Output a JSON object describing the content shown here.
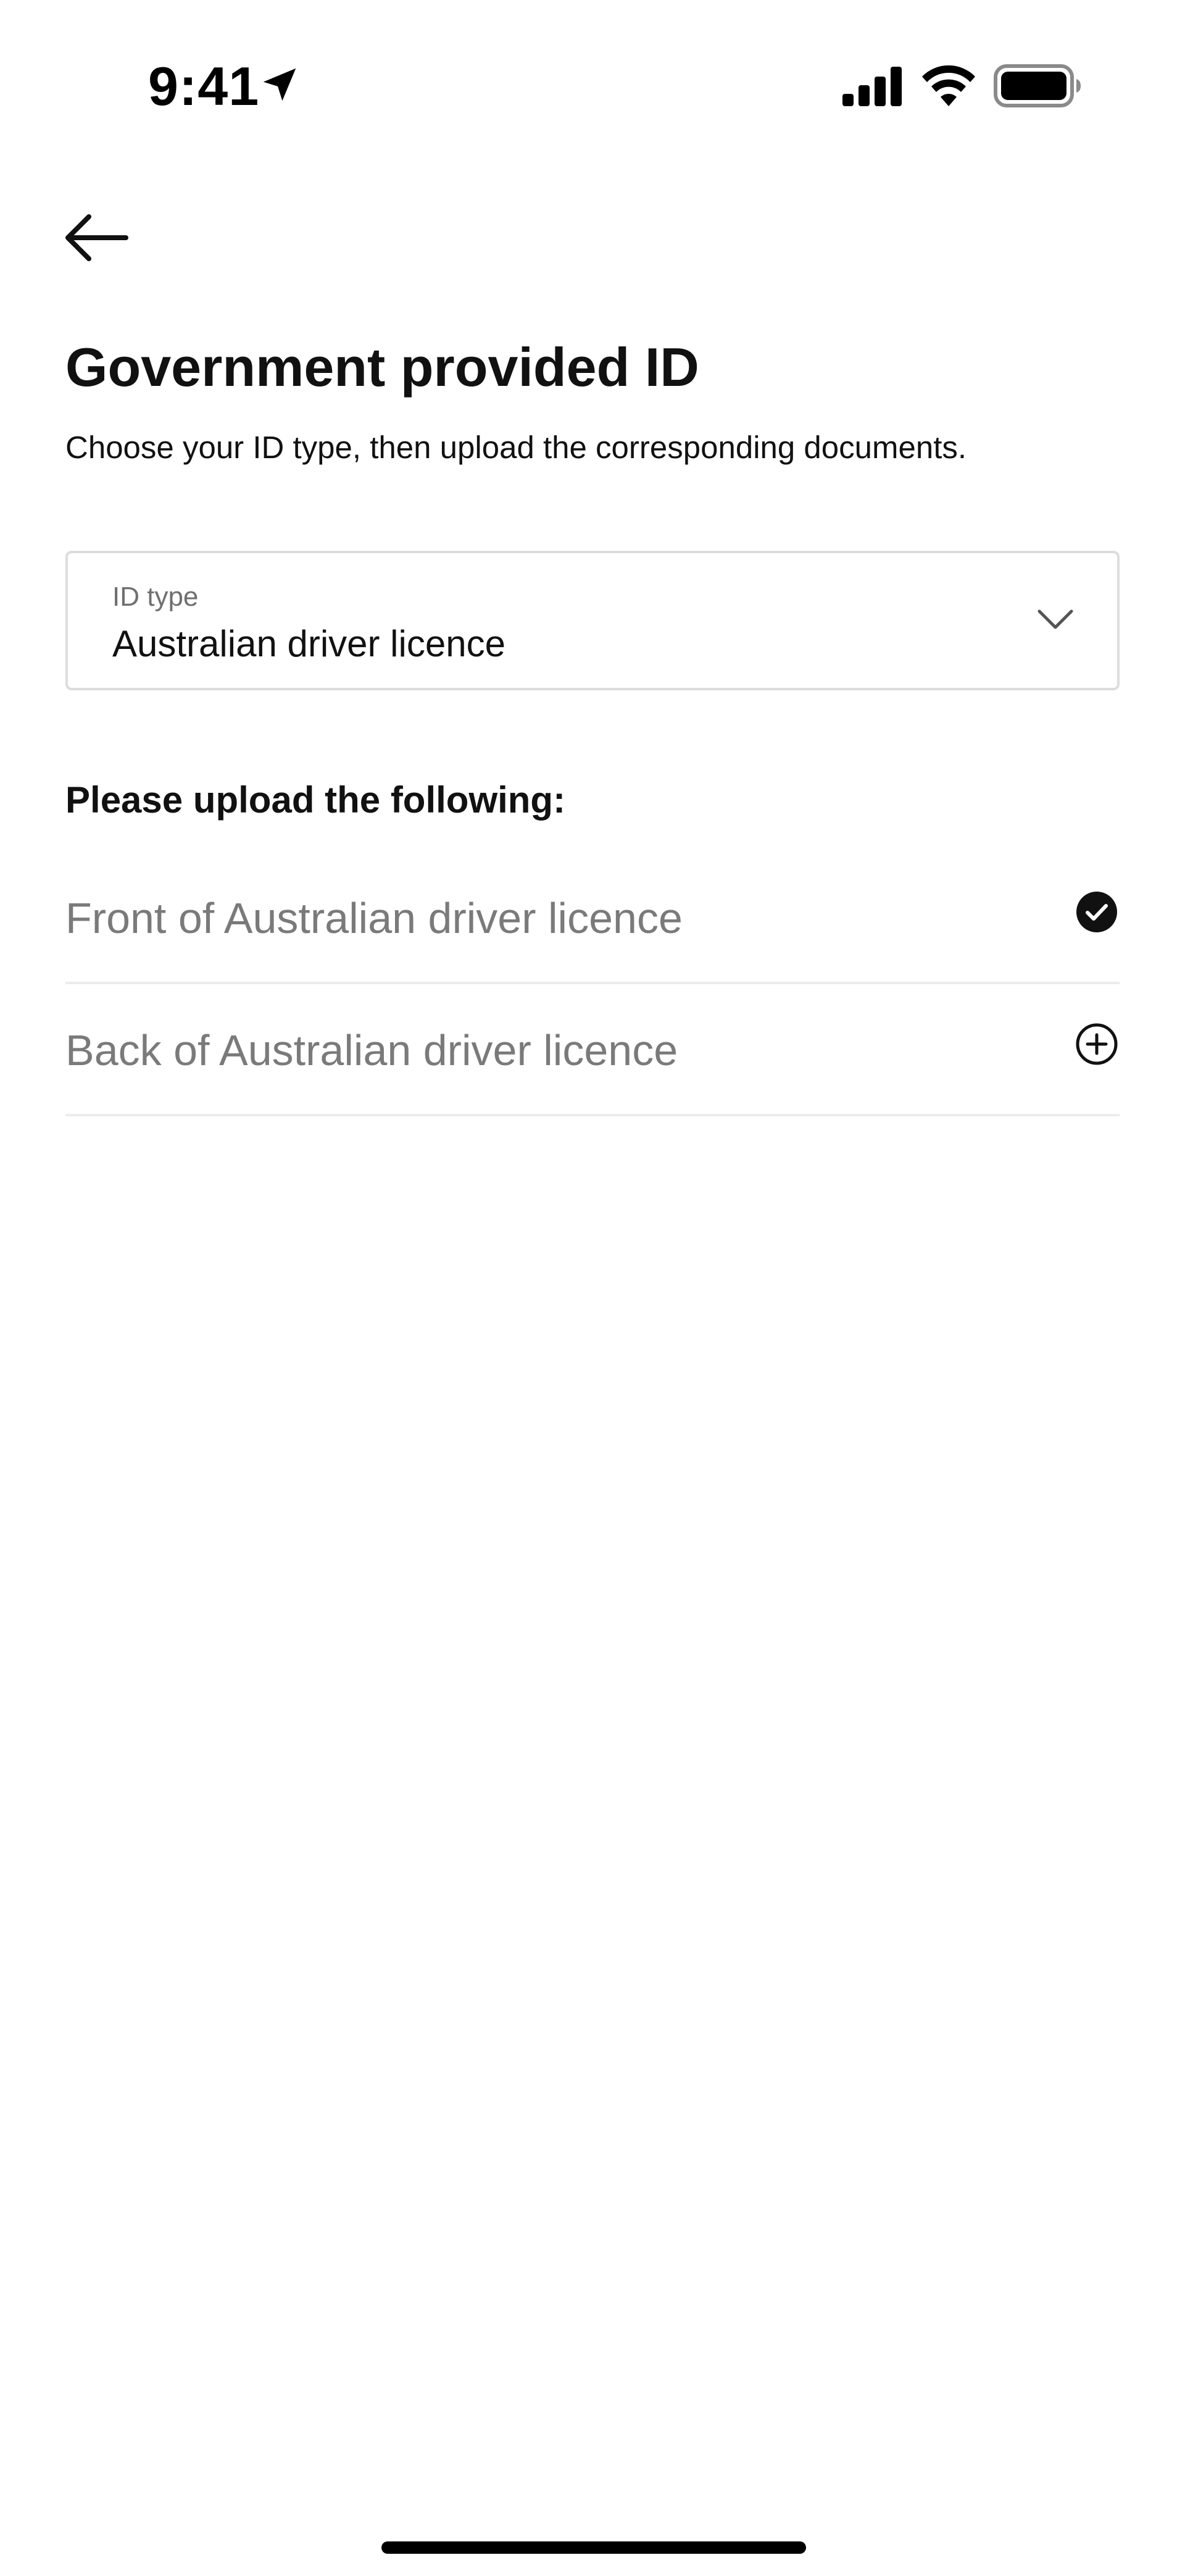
{
  "status_bar": {
    "time": "9:41",
    "icons": [
      "location-arrow-icon",
      "cellular-signal-icon",
      "wifi-icon",
      "battery-icon"
    ]
  },
  "header": {
    "back_icon": "arrow-left-icon",
    "title": "Government provided ID",
    "subtitle": "Choose your ID type, then upload the corresponding documents."
  },
  "id_type_select": {
    "label": "ID type",
    "value": "Australian driver licence",
    "icon": "chevron-down-icon"
  },
  "uploads": {
    "heading": "Please upload the following:",
    "items": [
      {
        "label": "Front of Australian driver licence",
        "status": "uploaded",
        "icon": "check-circle-filled-icon"
      },
      {
        "label": "Back of Australian driver licence",
        "status": "pending",
        "icon": "plus-circle-icon"
      }
    ]
  },
  "colors": {
    "text_primary": "#111111",
    "text_muted": "#7a7a7a",
    "border": "#dcdcdc",
    "divider": "#ececec",
    "background": "#ffffff"
  }
}
